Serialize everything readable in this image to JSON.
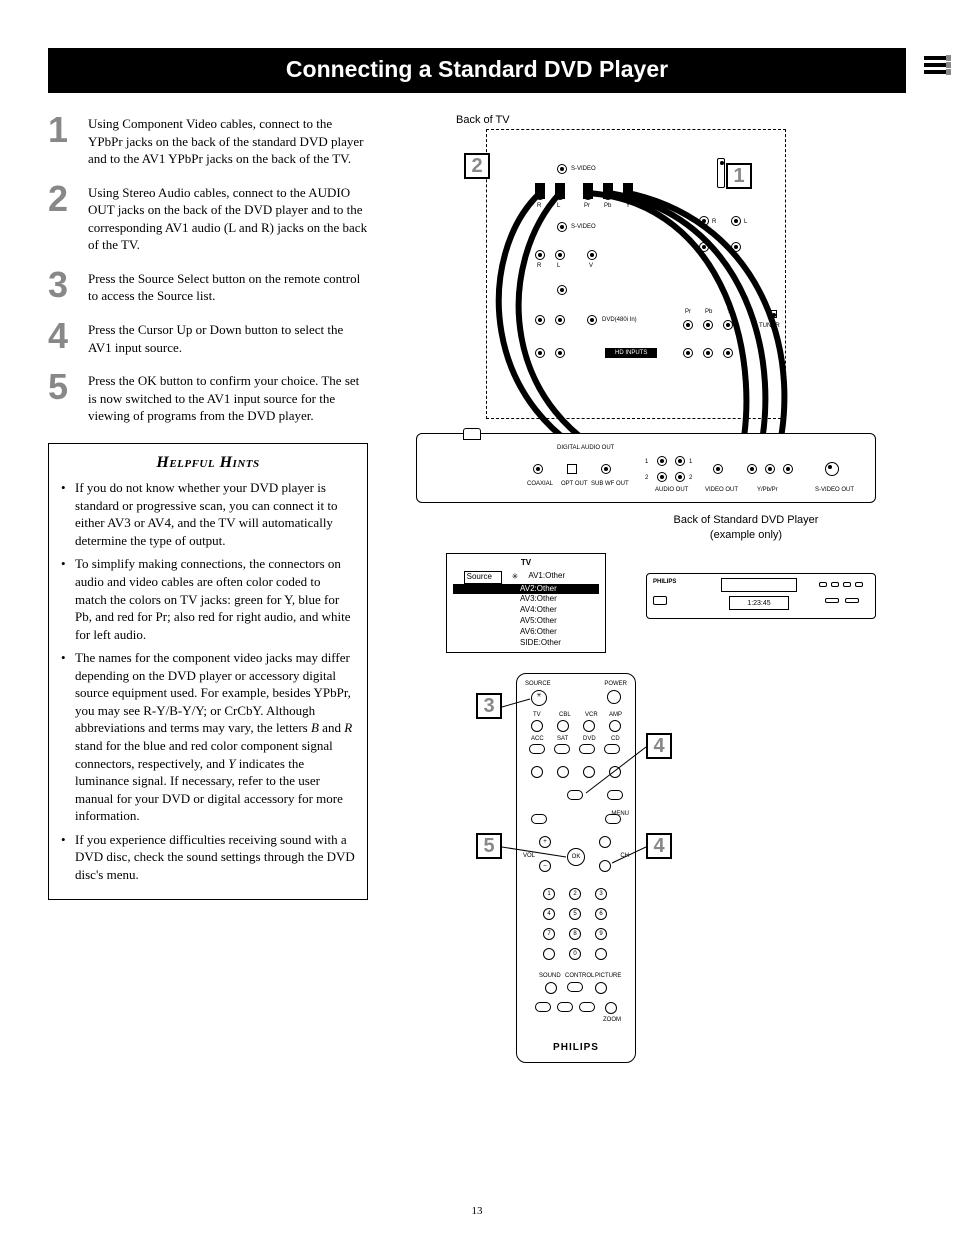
{
  "title": "Connecting a Standard DVD Player",
  "page_number": "13",
  "steps": [
    {
      "num": "1",
      "text": "Using Component Video cables, connect to the YPbPr jacks on the back of the standard DVD player and to the AV1 YPbPr jacks on the back of the TV."
    },
    {
      "num": "2",
      "text": "Using Stereo Audio cables, connect to the AUDIO OUT jacks on the back of the DVD player and to the corresponding AV1 audio (L and R) jacks on the back of the TV."
    },
    {
      "num": "3",
      "text": "Press the Source Select button on the remote control to access the Source list."
    },
    {
      "num": "4",
      "text": "Press the Cursor Up or Down button to select the AV1 input source."
    },
    {
      "num": "5",
      "text": "Press the OK button to confirm your choice. The set is now switched to the AV1 input source for the viewing of programs from the DVD player."
    }
  ],
  "hints": {
    "title": "Helpful Hints",
    "items": [
      "If you do not know whether your DVD player is standard or progressive scan, you can connect it to either AV3 or AV4, and the TV will automatically determine the type of output.",
      "To simplify making connections, the connectors on audio and video cables are often color coded to match the colors on TV jacks: green for Y, blue for Pb, and red for Pr; also red for right audio, and white for left audio.",
      "The names for the component video jacks may differ depending on the DVD player or accessory digital source equipment used. For example, besides YPbPr, you may see R-Y/B-Y/Y; or CrCbY. Although abbreviations and terms may vary, the letters B and R stand for the blue and red color component signal connectors, respectively, and Y indicates the luminance signal. If necessary, refer to the user manual for your DVD or digital accessory for more information.",
      "If you experience difficulties receiving sound with a DVD disc, check the sound settings through the DVD disc's menu."
    ]
  },
  "diagram": {
    "back_of_tv": "Back of TV",
    "back_of_dvd": "Back of Standard DVD Player\n(example only)",
    "dvd_display": "1:23:45",
    "tv_labels": {
      "svideo": "S-VIDEO",
      "r": "R",
      "l": "L",
      "v": "V",
      "y": "Y",
      "pb": "Pb",
      "pr": "Pr",
      "hd": "HD INPUTS",
      "tuner": "TUNER",
      "audio_in": "DVD(480i In)"
    },
    "dvd_labels": {
      "digital_audio": "DIGITAL AUDIO OUT",
      "coaxial": "COAXIAL",
      "opt": "OPT OUT",
      "sub": "SUB WF OUT",
      "audio_out": "AUDIO OUT",
      "video_out": "VIDEO OUT",
      "ypbpr": "Y/Pb/Pr",
      "svid": "S-VIDEO OUT"
    },
    "callouts": {
      "c1": "1",
      "c2": "2",
      "c3": "3",
      "c4a": "4",
      "c4b": "4",
      "c5": "5"
    },
    "osd": {
      "header": "TV",
      "leftcol": "Source",
      "rows": [
        "AV1:Other",
        "AV2:Other",
        "AV3:Other",
        "AV4:Other",
        "AV5:Other",
        "AV6:Other",
        "SIDE:Other"
      ]
    },
    "remote": {
      "brand": "PHILIPS",
      "top_labels": [
        "SOURCE",
        "POWER",
        "TV",
        "CBL",
        "VCR",
        "AMP",
        "ACC",
        "SAT",
        "DVD",
        "CD"
      ],
      "mid_labels": [
        "OK",
        "VOL",
        "CH",
        "+",
        "–",
        "MENU"
      ],
      "digits": [
        "1",
        "2",
        "3",
        "4",
        "5",
        "6",
        "7",
        "8",
        "9",
        "0"
      ],
      "bottom_labels": [
        "SOUND",
        "CONTROL",
        "PICTURE",
        "ZOOM"
      ]
    }
  }
}
